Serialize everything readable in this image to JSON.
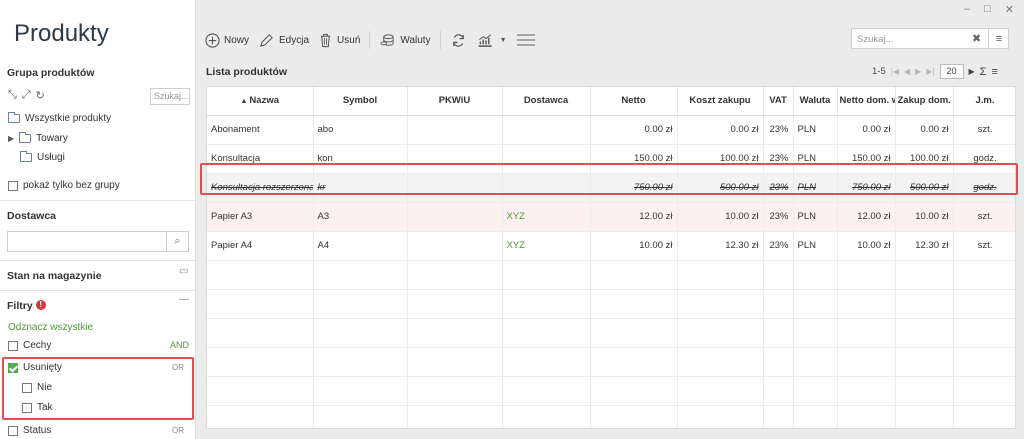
{
  "app": {
    "title": "Produkty"
  },
  "window_controls": [
    "–",
    "□",
    "✕"
  ],
  "sidebar": {
    "group_title": "Grupa produktów",
    "tree_search_placeholder": "Szukaj...",
    "tree": [
      {
        "label": "Wszystkie produkty",
        "expandable": false
      },
      {
        "label": "Towary",
        "expandable": true
      },
      {
        "label": "Usługi",
        "expandable": false
      }
    ],
    "ungrouped_label": "pokaż tylko bez grupy",
    "supplier_title": "Dostawca",
    "supplier_value": "",
    "stock_title": "Stan na magazynie",
    "filters_title": "Filtry",
    "filters_badge": "!",
    "uncheck_all": "Odznacz wszystkie",
    "filters": [
      {
        "label": "Cechy",
        "op": "AND",
        "checked": false
      },
      {
        "label": "Usunięty",
        "op": "OR",
        "checked": true
      },
      {
        "label": "Nie",
        "op": "",
        "checked": false
      },
      {
        "label": "Tak",
        "op": "",
        "checked": false
      },
      {
        "label": "Status",
        "op": "OR",
        "checked": false
      }
    ]
  },
  "toolbar": {
    "new_label": "Nowy",
    "edit_label": "Edycja",
    "delete_label": "Usuń",
    "currencies_label": "Waluty"
  },
  "search": {
    "placeholder": "Szukaj..."
  },
  "list": {
    "title": "Lista produktów",
    "range": "1-5",
    "page_size": "20",
    "sum_symbol": "Σ"
  },
  "table": {
    "columns": [
      "Nazwa",
      "Symbol",
      "PKWiU",
      "Dostawca",
      "Netto",
      "Koszt zakupu",
      "VAT",
      "Waluta",
      "Netto dom. w",
      "Zakup dom. w",
      "J.m."
    ],
    "rows": [
      {
        "name": "Abonament",
        "symbol": "abo",
        "pkwiu": "",
        "supplier": "",
        "net": "0.00 zł",
        "cost": "0.00 zł",
        "vat": "23%",
        "currency": "PLN",
        "net_dom": "0.00 zł",
        "cost_dom": "0.00 zł",
        "unit": "szt.",
        "state": "normal"
      },
      {
        "name": "Konsultacja",
        "symbol": "kon",
        "pkwiu": "",
        "supplier": "",
        "net": "150.00 zł",
        "cost": "100.00 zł",
        "vat": "23%",
        "currency": "PLN",
        "net_dom": "150.00 zł",
        "cost_dom": "100.00 zł",
        "unit": "godz.",
        "state": "normal"
      },
      {
        "name": "Konsultacja rozszerzona",
        "symbol": "kr",
        "pkwiu": "",
        "supplier": "",
        "net": "750.00 zł",
        "cost": "500.00 zł",
        "vat": "23%",
        "currency": "PLN",
        "net_dom": "750.00 zł",
        "cost_dom": "500.00 zł",
        "unit": "godz.",
        "state": "deleted"
      },
      {
        "name": "Papier A3",
        "symbol": "A3",
        "pkwiu": "",
        "supplier": "XYZ",
        "net": "12.00 zł",
        "cost": "10.00 zł",
        "vat": "23%",
        "currency": "PLN",
        "net_dom": "12.00 zł",
        "cost_dom": "10.00 zł",
        "unit": "szt.",
        "state": "pink"
      },
      {
        "name": "Papier A4",
        "symbol": "A4",
        "pkwiu": "",
        "supplier": "XYZ",
        "net": "10.00 zł",
        "cost": "12.30 zł",
        "vat": "23%",
        "currency": "PLN",
        "net_dom": "10.00 zł",
        "cost_dom": "12.30 zł",
        "unit": "szt.",
        "state": "normal"
      }
    ]
  },
  "colors": {
    "accent_green": "#4f9a3a",
    "highlight_red": "#e05050",
    "title": "#2b3a45"
  }
}
